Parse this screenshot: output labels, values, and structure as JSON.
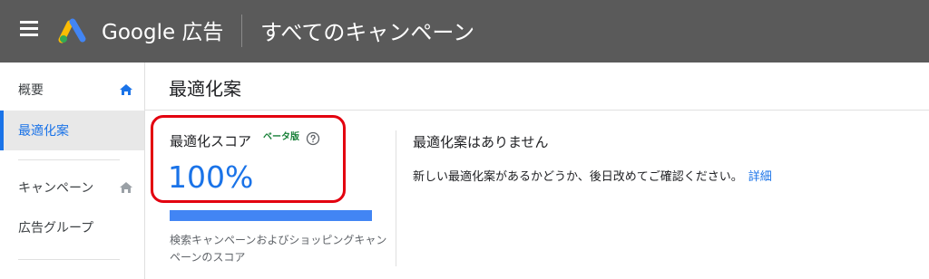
{
  "header": {
    "brand": "Google 広告",
    "title": "すべてのキャンペーン"
  },
  "sidebar": {
    "items": [
      {
        "label": "概要",
        "icon": "home-icon"
      },
      {
        "label": "最適化案"
      },
      {
        "label": "キャンペーン",
        "icon": "home-icon"
      },
      {
        "label": "広告グループ"
      }
    ]
  },
  "main": {
    "title": "最適化案",
    "score": {
      "label": "最適化スコア",
      "beta": "ベータ版",
      "value": "100%",
      "progress": 1.0,
      "description": "検索キャンペーンおよびショッピングキャンペーンのスコア"
    },
    "no_recommendations": {
      "title": "最適化案はありません",
      "message": "新しい最適化案があるかどうか、後日改めてご確認ください。",
      "link": "詳細"
    }
  },
  "colors": {
    "topbar": "#5a5a5a",
    "accent": "#1a73e8",
    "progress": "#4285f4",
    "highlight": "#e3000f",
    "beta": "#188038"
  }
}
